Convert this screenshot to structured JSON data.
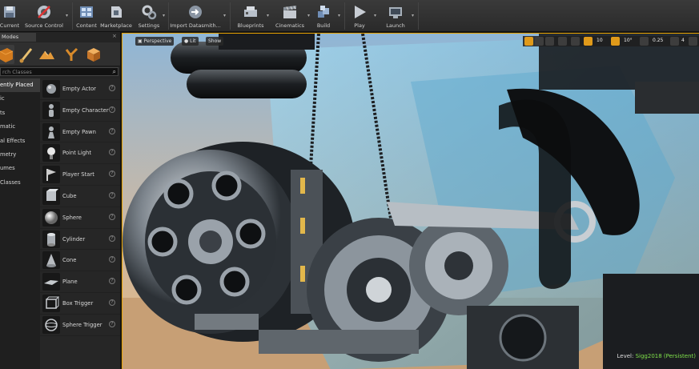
{
  "toolbar": {
    "buttons": [
      {
        "label": "Current",
        "icon": "save-icon"
      },
      {
        "label": "Source Control",
        "icon": "source-control-icon"
      },
      {
        "label": "Content",
        "icon": "content-browser-icon"
      },
      {
        "label": "Marketplace",
        "icon": "marketplace-icon"
      },
      {
        "label": "Settings",
        "icon": "settings-icon"
      },
      {
        "label": "Import Datasmith...",
        "icon": "datasmith-icon"
      },
      {
        "label": "Blueprints",
        "icon": "blueprints-icon"
      },
      {
        "label": "Cinematics",
        "icon": "cinematics-icon"
      },
      {
        "label": "Build",
        "icon": "build-icon"
      },
      {
        "label": "Play",
        "icon": "play-icon"
      },
      {
        "label": "Launch",
        "icon": "launch-icon"
      }
    ]
  },
  "modes": {
    "tab_label": "Modes",
    "close_glyph": "×",
    "search_placeholder": "rch Classes",
    "categories": [
      {
        "label": "ently Placed",
        "active": true
      },
      {
        "label": "ic",
        "active": false
      },
      {
        "label": "ts",
        "active": false
      },
      {
        "label": "matic",
        "active": false
      },
      {
        "label": "al Effects",
        "active": false
      },
      {
        "label": "metry",
        "active": false
      },
      {
        "label": "umes",
        "active": false
      },
      {
        "label": "Classes",
        "active": false
      }
    ],
    "items": [
      {
        "label": "Empty Actor",
        "icon": "empty-actor-icon"
      },
      {
        "label": "Empty Character",
        "icon": "empty-character-icon"
      },
      {
        "label": "Empty Pawn",
        "icon": "empty-pawn-icon"
      },
      {
        "label": "Point Light",
        "icon": "point-light-icon"
      },
      {
        "label": "Player Start",
        "icon": "player-start-icon"
      },
      {
        "label": "Cube",
        "icon": "cube-icon"
      },
      {
        "label": "Sphere",
        "icon": "sphere-icon"
      },
      {
        "label": "Cylinder",
        "icon": "cylinder-icon"
      },
      {
        "label": "Cone",
        "icon": "cone-icon"
      },
      {
        "label": "Plane",
        "icon": "plane-icon"
      },
      {
        "label": "Box Trigger",
        "icon": "box-trigger-icon"
      },
      {
        "label": "Sphere Trigger",
        "icon": "sphere-trigger-icon"
      }
    ]
  },
  "viewport": {
    "perspective_label": "Perspective",
    "lit_label": "Lit",
    "show_label": "Show",
    "grid_snap_value": "10",
    "rotation_snap_value": "10°",
    "scale_snap_value": "0.25",
    "camera_speed_value": "4",
    "level_prefix": "Level:",
    "level_name": "Sigg2018 (Persistent)",
    "accent_color": "#e6a200"
  }
}
